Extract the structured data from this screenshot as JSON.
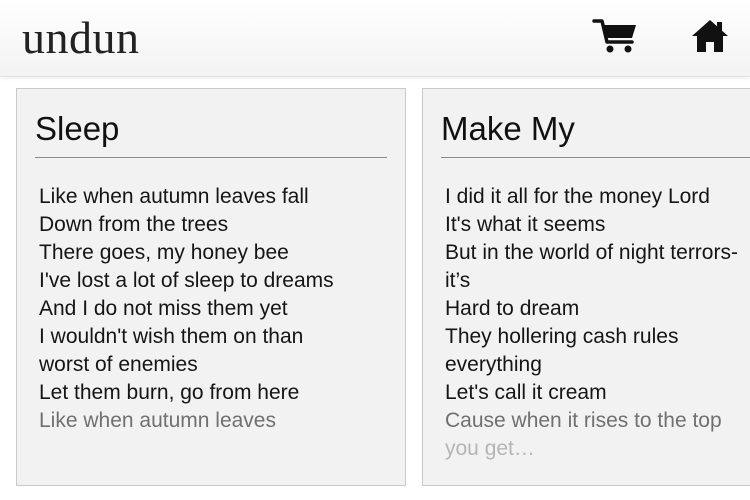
{
  "header": {
    "brand": "undun",
    "icons": [
      "cart-icon",
      "home-icon"
    ]
  },
  "cards": [
    {
      "title": "Sleep",
      "lines": [
        "Like when autumn leaves fall",
        "Down from the trees",
        "There goes, my honey bee",
        "I've lost a lot of sleep to dreams",
        "And I do not miss them yet",
        "I wouldn't wish them on than",
        "worst of enemies",
        "Let them burn, go from here",
        "Like when autumn leaves"
      ]
    },
    {
      "title": "Make My",
      "lines": [
        "I did it all for the money Lord",
        "It's what it seems",
        "But in the world of night terrors-",
        "it’s",
        "Hard to dream",
        "They hollering cash rules",
        "everything",
        "Let's call it cream",
        "Cause when it rises to the top",
        "you get…"
      ]
    }
  ]
}
